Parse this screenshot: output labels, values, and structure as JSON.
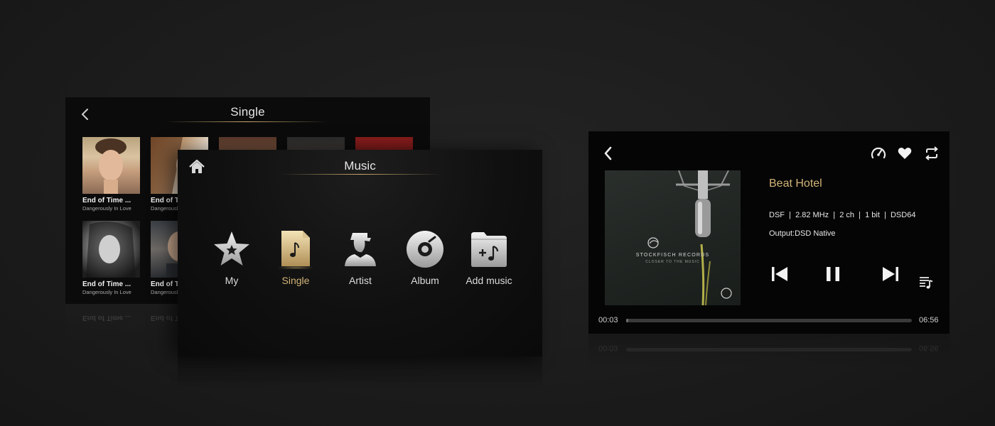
{
  "single_screen": {
    "title": "Single",
    "tiles": [
      {
        "title": "End of Time ...",
        "subtitle": "Dangerously In Love"
      },
      {
        "title": "End of Time ...",
        "subtitle": "Dangerously In Love"
      },
      {
        "title": "",
        "subtitle": ""
      },
      {
        "title": "",
        "subtitle": ""
      },
      {
        "title": "",
        "subtitle": ""
      },
      {
        "title": "End of Time ...",
        "subtitle": "Dangerously In Love"
      },
      {
        "title": "End of Time ...",
        "subtitle": "Dangerously In Love"
      }
    ]
  },
  "music_screen": {
    "title": "Music",
    "menu": [
      {
        "label": "My",
        "icon": "star-icon",
        "active": false
      },
      {
        "label": "Single",
        "icon": "music-note-icon",
        "active": true
      },
      {
        "label": "Artist",
        "icon": "artist-icon",
        "active": false
      },
      {
        "label": "Album",
        "icon": "disc-icon",
        "active": false
      },
      {
        "label": "Add music",
        "icon": "add-music-folder-icon",
        "active": false
      }
    ]
  },
  "player": {
    "track_title": "Beat Hotel",
    "format_info": "DSF  |  2.82 MHz  |  2 ch  |  1 bit  |  DSD64",
    "output": "Output:DSD Native",
    "elapsed": "00:03",
    "duration": "06:56",
    "progress": 0.007,
    "cover": {
      "label": "STOCKFISCH RECORDS",
      "sublabel": "CLOSER TO THE MUSIC"
    }
  },
  "colors": {
    "accent_gold": "#d2b478",
    "background": "#1c1c1c"
  }
}
